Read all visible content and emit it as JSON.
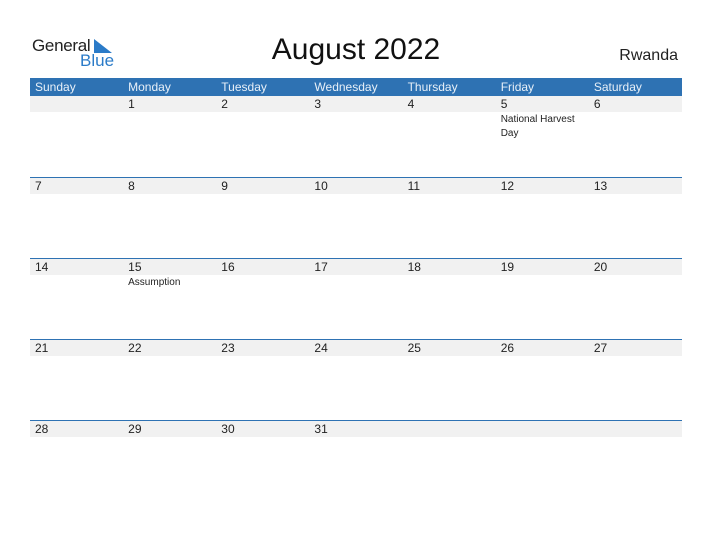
{
  "logo": {
    "line1": "General",
    "line2": "Blue",
    "accent": "#2b7bc8"
  },
  "title": "August 2022",
  "country": "Rwanda",
  "header_color": "#2e72b3",
  "weekdays": [
    "Sunday",
    "Monday",
    "Tuesday",
    "Wednesday",
    "Thursday",
    "Friday",
    "Saturday"
  ],
  "weeks": [
    [
      {
        "d": ""
      },
      {
        "d": "1"
      },
      {
        "d": "2"
      },
      {
        "d": "3"
      },
      {
        "d": "4"
      },
      {
        "d": "5",
        "event": "National Harvest Day"
      },
      {
        "d": "6"
      }
    ],
    [
      {
        "d": "7"
      },
      {
        "d": "8"
      },
      {
        "d": "9"
      },
      {
        "d": "10"
      },
      {
        "d": "11"
      },
      {
        "d": "12"
      },
      {
        "d": "13"
      }
    ],
    [
      {
        "d": "14"
      },
      {
        "d": "15",
        "event": "Assumption"
      },
      {
        "d": "16"
      },
      {
        "d": "17"
      },
      {
        "d": "18"
      },
      {
        "d": "19"
      },
      {
        "d": "20"
      }
    ],
    [
      {
        "d": "21"
      },
      {
        "d": "22"
      },
      {
        "d": "23"
      },
      {
        "d": "24"
      },
      {
        "d": "25"
      },
      {
        "d": "26"
      },
      {
        "d": "27"
      }
    ],
    [
      {
        "d": "28"
      },
      {
        "d": "29"
      },
      {
        "d": "30"
      },
      {
        "d": "31"
      },
      {
        "d": ""
      },
      {
        "d": ""
      },
      {
        "d": ""
      }
    ]
  ]
}
